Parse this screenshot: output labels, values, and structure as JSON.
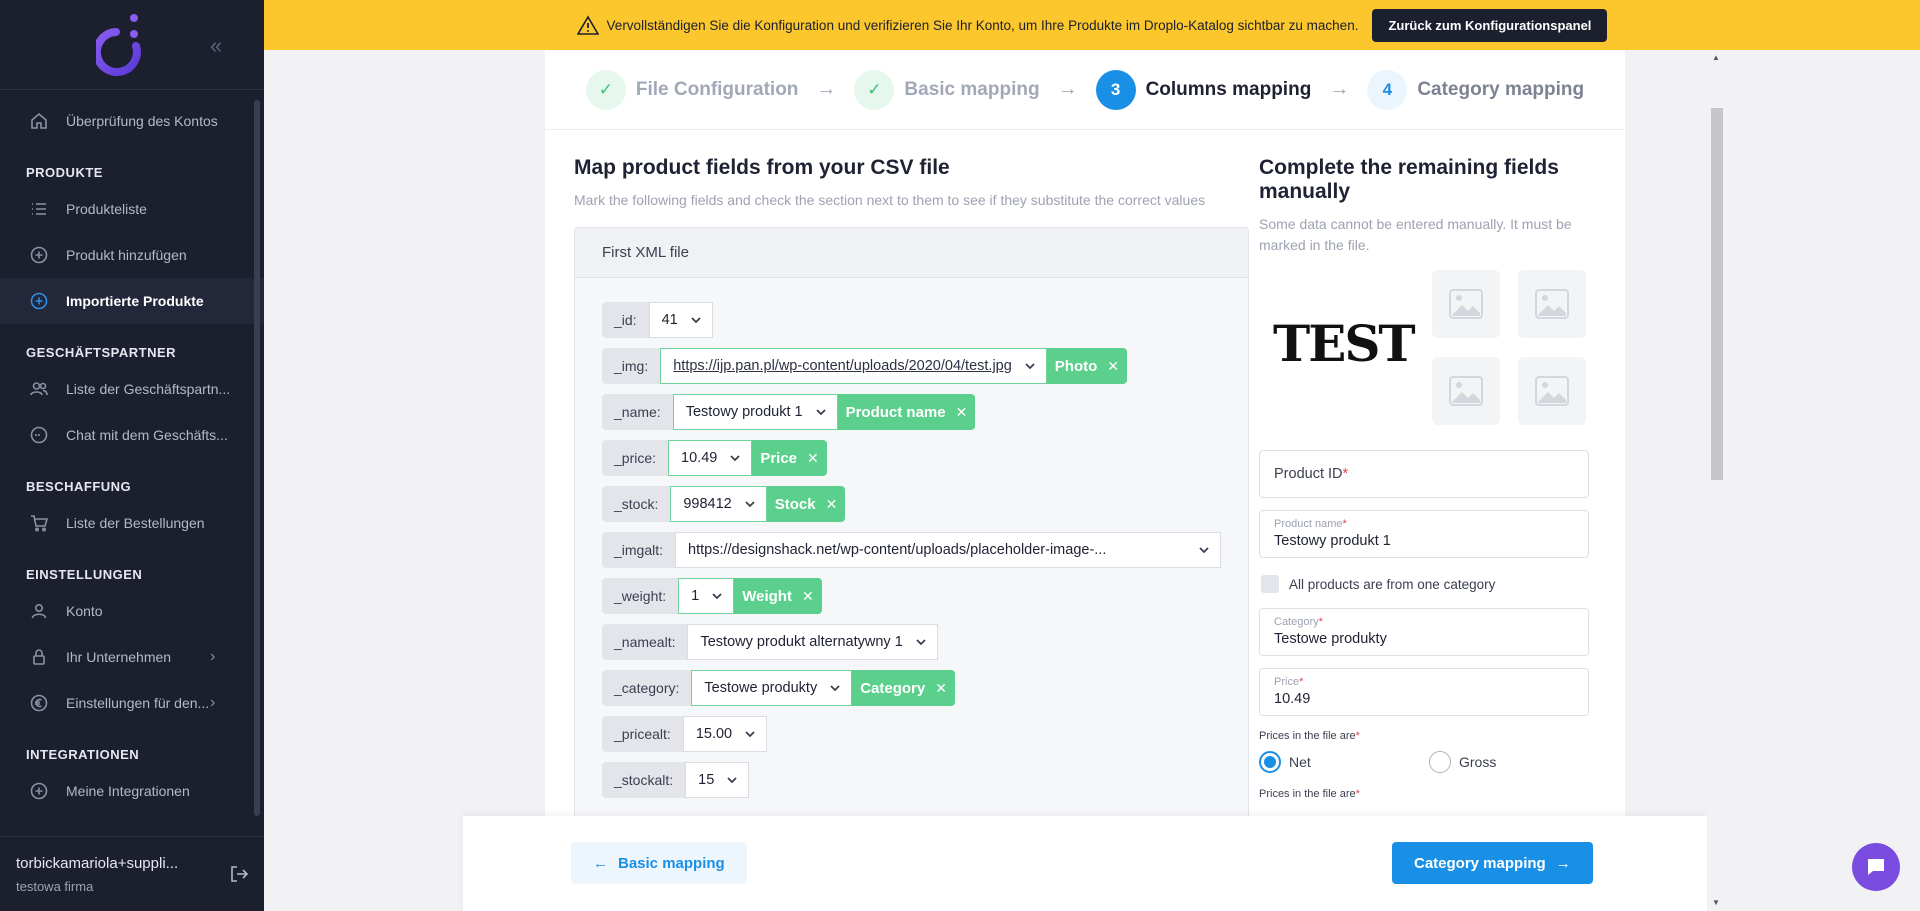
{
  "banner": {
    "text": "Vervollständigen Sie die Konfiguration und verifizieren Sie Ihr Konto, um Ihre Produkte im Droplo-Katalog sichtbar zu machen.",
    "button": "Zurück zum Konfigurationspanel"
  },
  "sidebar": {
    "account_review": "Überprüfung des Kontos",
    "sections": [
      {
        "title": "PRODUKTE",
        "items": [
          "Produkteliste",
          "Produkt hinzufügen",
          "Importierte Produkte"
        ]
      },
      {
        "title": "GESCHÄFTSPARTNER",
        "items": [
          "Liste der Geschäftspartn...",
          "Chat mit dem Geschäfts..."
        ]
      },
      {
        "title": "BESCHAFFUNG",
        "items": [
          "Liste der Bestellungen"
        ]
      },
      {
        "title": "EINSTELLUNGEN",
        "items": [
          "Konto",
          "Ihr Unternehmen",
          "Einstellungen für den..."
        ]
      },
      {
        "title": "INTEGRATIONEN",
        "items": [
          "Meine Integrationen"
        ]
      }
    ],
    "user_name": "torbickamariola+suppli...",
    "user_company": "testowa firma"
  },
  "stepper": {
    "steps": [
      {
        "number": "✓",
        "label": "File Configuration",
        "state": "done"
      },
      {
        "number": "✓",
        "label": "Basic mapping",
        "state": "done"
      },
      {
        "number": "3",
        "label": "Columns mapping",
        "state": "current"
      },
      {
        "number": "4",
        "label": "Category mapping",
        "state": "next"
      }
    ]
  },
  "left": {
    "title": "Map product fields from your CSV file",
    "subtitle": "Mark the following fields and check the section next to them to see if they substitute the correct values",
    "box_title": "First XML file",
    "rows": [
      {
        "field": "_id:",
        "value": "41",
        "badge": ""
      },
      {
        "field": "_img:",
        "value": "https://ijp.pan.pl/wp-content/uploads/2020/04/test.jpg",
        "badge": "Photo"
      },
      {
        "field": "_name:",
        "value": "Testowy produkt 1",
        "badge": "Product name"
      },
      {
        "field": "_price:",
        "value": "10.49",
        "badge": "Price"
      },
      {
        "field": "_stock:",
        "value": "998412",
        "badge": "Stock"
      },
      {
        "field": "_imgalt:",
        "value": "https://designshack.net/wp-content/uploads/placeholder-image-...",
        "badge": ""
      },
      {
        "field": "_weight:",
        "value": "1",
        "badge": "Weight"
      },
      {
        "field": "_namealt:",
        "value": "Testowy produkt alternatywny 1",
        "badge": ""
      },
      {
        "field": "_category:",
        "value": "Testowe produkty",
        "badge": "Category"
      },
      {
        "field": "_pricealt:",
        "value": "15.00",
        "badge": ""
      },
      {
        "field": "_stockalt:",
        "value": "15",
        "badge": ""
      }
    ]
  },
  "right": {
    "title": "Complete the remaining fields manually",
    "subtitle": "Some data cannot be entered manually. It must be marked in the file.",
    "image_text": "TEST",
    "product_id_label": "Product ID",
    "product_name_label": "Product name",
    "product_name_value": "Testowy produkt 1",
    "one_category_label": "All products are from one category",
    "category_label": "Category",
    "category_value": "Testowe produkty",
    "price_label": "Price",
    "price_value": "10.49",
    "prices_label": "Prices in the file are",
    "net": "Net",
    "gross": "Gross",
    "prices_label2": "Prices in the file are",
    "required_mark": "*"
  },
  "footer": {
    "back": "Basic mapping",
    "next": "Category mapping"
  },
  "colors": {
    "accent": "#1a8fe6",
    "success": "#5bcf8c",
    "banner": "#fbc72d",
    "sidebar": "#1c1f2e"
  }
}
